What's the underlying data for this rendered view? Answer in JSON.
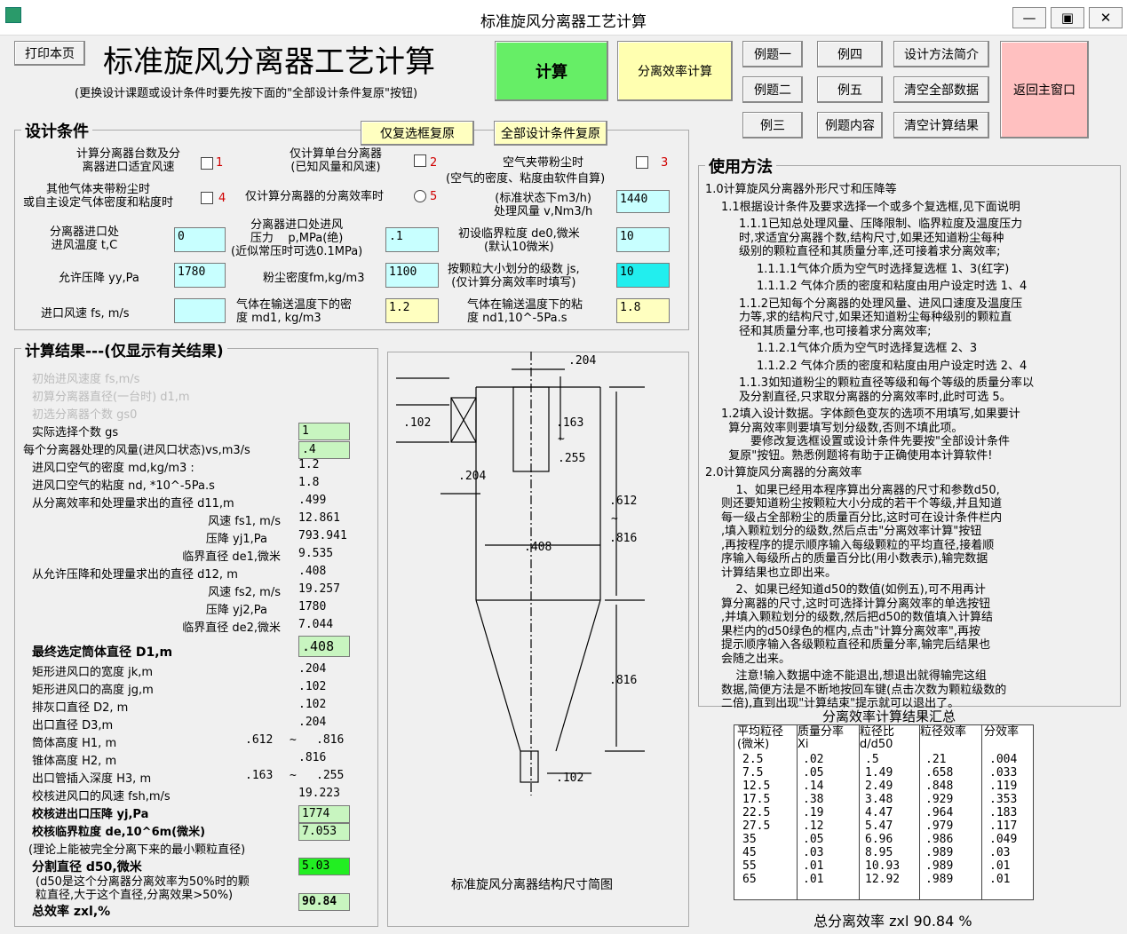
{
  "window": {
    "title": "标准旋风分离器工艺计算"
  },
  "header": {
    "print_button": "打印本页",
    "big_title": "标准旋风分离器工艺计算",
    "hint": "(更换设计课题或设计条件时要先按下面的\"全部设计条件复原\"按钮)",
    "calc_button": "计算",
    "eff_button": "分离效率计算",
    "examples": [
      "例题一",
      "例四",
      "例题二",
      "例五",
      "例三",
      "例题内容"
    ],
    "design_intro": "设计方法简介",
    "clear_all": "清空全部数据",
    "clear_results": "清空计算结果",
    "return_main": "返回主窗口",
    "reset_checked": "仅复选框复原",
    "reset_all": "全部设计条件复原"
  },
  "conditions": {
    "title": "设计条件",
    "opt1": {
      "text": "计算分离器台数及分\n离器进口适宜风速",
      "num": "1"
    },
    "opt2": {
      "text": "仅计算单台分离器\n(已知风量和风速)",
      "num": "2"
    },
    "opt3": {
      "text": "空气夹带粉尘时",
      "num": "3"
    },
    "opt3b": "(空气的密度、粘度由软件自算)",
    "opt4": {
      "text": "其他气体夹带粉尘时\n或自主设定气体密度和粘度时",
      "num": "4"
    },
    "opt5": {
      "text": "仅计算分离器的分离效率时",
      "num": "5"
    },
    "flow_label": "(标准状态下m3/h)\n处理风量 v,Nm3/h",
    "flow_value": "1440",
    "temp_label": "分离器进口处\n进风温度 t,C",
    "temp_value": "0",
    "pressure_label": "分离器进口处进风\n压力    p,MPa(绝)\n(近似常压时可选0.1MPa)",
    "pressure_value": ".1",
    "de0_label": "初设临界粒度 de0,微米\n(默认10微米)",
    "de0_value": "10",
    "allow_label": "允许压降 yy,Pa",
    "allow_value": "1780",
    "dust_label": "粉尘密度fm,kg/m3",
    "dust_value": "1100",
    "js_label": "按颗粒大小划分的级数 js,\n(仅计算分离效率时填写)",
    "js_value": "10",
    "fs_label": "进口风速 fs, m/s",
    "fs_value": "",
    "md1_label": "气体在输送温度下的密\n度 md1, kg/m3",
    "md1_value": "1.2",
    "nd1_label": "气体在输送温度下的粘\n度 nd1,10^-5Pa.s",
    "nd1_value": "1.8"
  },
  "results": {
    "title": "计算结果---(仅显示有关结果)",
    "gray_lines": [
      "初始进风速度 fs,m/s",
      "初算分离器直径(一台时) d1,m",
      "初选分离器个数 gs0"
    ],
    "gs_label": "实际选择个数 gs",
    "gs_value": "1",
    "vs_label": "每个分离器处理的风量(进风口状态)vs,m3/s",
    "vs_value": ".4",
    "rows_a": [
      {
        "label": "进风口空气的密度 md,kg/m3 :",
        "value": "1.2"
      },
      {
        "label": "进风口空气的粘度 nd, *10^-5Pa.s",
        "value": "1.8"
      },
      {
        "label": "从分离效率和处理量求出的直径 d11,m",
        "value": ".499"
      }
    ],
    "rows_a_right": [
      {
        "label": "风速 fs1, m/s",
        "value": "12.861"
      },
      {
        "label": "压降 yj1,Pa",
        "value": "793.941"
      },
      {
        "label": "临界直径 de1,微米",
        "value": "9.535"
      }
    ],
    "d12_label": "从允许压降和处理量求出的直径 d12, m",
    "d12_value": ".408",
    "rows_b_right": [
      {
        "label": "风速 fs2, m/s",
        "value": "19.257"
      },
      {
        "label": "压降 yj2,Pa",
        "value": "1780"
      },
      {
        "label": "临界直径 de2,微米",
        "value": "7.044"
      }
    ],
    "d1_label": "最终选定筒体直径 D1,m",
    "d1_value": ".408",
    "rows_c": [
      {
        "label": "矩形进风口的宽度 jk,m",
        "value": ".204"
      },
      {
        "label": "矩形进风口的高度 jg,m",
        "value": ".102"
      },
      {
        "label": "排灰口直径 D2, m",
        "value": ".102"
      },
      {
        "label": "出口直径 D3,m",
        "value": ".204"
      }
    ],
    "h1_label": "筒体高度 H1, m",
    "h1_from": ".612",
    "h1_tilde": "~",
    "h1_to": ".816",
    "h2_label": "锥体高度 H2, m",
    "h2_value": ".816",
    "h3_label": "出口管插入深度 H3, m",
    "h3_from": ".163",
    "h3_tilde": "~",
    "h3_to": ".255",
    "fsh_label": "校核进风口的风速 fsh,m/s",
    "fsh_value": "19.223",
    "yj_label": "校核进出口压降 yj,Pa",
    "yj_value": "1774",
    "de_label": "校核临界粒度 de,10^6m(微米)",
    "de_value": "7.053",
    "de_note": "(理论上能被完全分离下来的最小颗粒直径)",
    "d50_label": "分割直径 d50,微米",
    "d50_value": "5.03",
    "d50_note": "(d50是这个分离器分离效率为50%时的颗\n粒直径,大于这个直径,分离效果>50%)",
    "zxl_label": "总效率 zxl,%",
    "zxl_value": "90.84"
  },
  "diagram": {
    "caption": "标准旋风分离器结构尺寸简图",
    "dims": {
      "top": ".204",
      "inlet_h": ".102",
      "insert1": ".163",
      "tilde1": "~",
      "insert2": ".255",
      "inlet_w": ".204",
      "body1": ".612",
      "tilde2": "~",
      "body2": ".816",
      "dia": ".408",
      "cone": ".816",
      "bottom": ".102"
    }
  },
  "usage": {
    "title": "使用方法",
    "lines": [
      {
        "text": "1.0计算旋风分离器外形尺寸和压降等",
        "indent": 0
      },
      {
        "text": "1.1根据设计条件及要求选择一个或多个复选框,见下面说明",
        "indent": 1
      },
      {
        "text": "1.1.1已知总处理风量、压降限制、临界粒度及温度压力\n时,求适宜分离器个数,结构尺寸,如果还知道粉尘每种\n级别的颗粒直径和其质量分率,还可接着求分离效率;",
        "indent": 2
      },
      {
        "text": "1.1.1.1气体介质为空气时选择复选框 1、3(红字)",
        "indent": 3
      },
      {
        "text": "1.1.1.2 气体介质的密度和粘度由用户设定时选 1、4",
        "indent": 3
      },
      {
        "text": "1.1.2已知每个分离器的处理风量、进风口速度及温度压\n力等,求的结构尺寸,如果还知道粉尘每种级别的颗粒直\n径和其质量分率,也可接着求分离效率;",
        "indent": 2
      },
      {
        "text": "1.1.2.1气体介质为空气时选择复选框 2、3",
        "indent": 3
      },
      {
        "text": "1.1.2.2 气体介质的密度和粘度由用户设定时选 2、4",
        "indent": 3
      },
      {
        "text": "1.1.3如知道粉尘的颗粒直径等级和每个等级的质量分率以\n及分割直径,只求取分离器的分离效率时,此时可选 5。",
        "indent": 2
      },
      {
        "text": "1.2填入设计数据。字体颜色变灰的选项不用填写,如果要计\n  算分离效率则要填写划分级数,否则不填此项。\n        要修改复选框设置或设计条件先要按\"全部设计条件\n  复原\"按钮。熟悉例题将有助于正确使用本计算软件!",
        "indent": 1
      },
      {
        "text": "2.0计算旋风分离器的分离效率",
        "indent": 0
      },
      {
        "text": "    1、如果已经用本程序算出分离器的尺寸和参数d50,\n则还要知道粉尘按颗粒大小分成的若干个等级,并且知道\n每一级占全部粉尘的质量百分比,这时可在设计条件栏内\n,填入颗粒划分的级数,然后点击\"分离效率计算\"按钮\n,再按程序的提示顺序输入每级颗粒的平均直径,接着顺\n序输入每级所占的质量百分比(用小数表示),输完数据\n计算结果也立即出来。",
        "indent": 1
      },
      {
        "text": "    2、如果已经知道d50的数值(如例五),可不用再计\n算分离器的尺寸,这时可选择计算分离效率的单选按钮\n,并填入颗粒划分的级数,然后把d50的数值填入计算结\n果栏内的d50绿色的框内,点击\"计算分离效率\",再按\n提示顺序输入各级颗粒直径和质量分率,输完后结果也\n会随之出来。",
        "indent": 1
      },
      {
        "text": "    注意!输入数据中途不能退出,想退出就得输完这组\n数据,简便方法是不断地按回车键(点击次数为颗粒级数的\n二倍),直到出现\"计算结束\"提示就可以退出了。",
        "indent": 1
      }
    ]
  },
  "summary": {
    "title": "分离效率计算结果汇总",
    "headers": [
      "平均粒径\n(微米)",
      "质量分率\nXi",
      "粒径比\nd/d50",
      "粒径效率",
      "分效率"
    ],
    "rows": [
      [
        "2.5",
        ".02",
        ".5",
        ".21",
        ".004"
      ],
      [
        "7.5",
        ".05",
        "1.49",
        ".658",
        ".033"
      ],
      [
        "12.5",
        ".14",
        "2.49",
        ".848",
        ".119"
      ],
      [
        "17.5",
        ".38",
        "3.48",
        ".929",
        ".353"
      ],
      [
        "22.5",
        ".19",
        "4.47",
        ".964",
        ".183"
      ],
      [
        "27.5",
        ".12",
        "5.47",
        ".979",
        ".117"
      ],
      [
        "35",
        ".05",
        "6.96",
        ".986",
        ".049"
      ],
      [
        "45",
        ".03",
        "8.95",
        ".989",
        ".03"
      ],
      [
        "55",
        ".01",
        "10.93",
        ".989",
        ".01"
      ],
      [
        "65",
        ".01",
        "12.92",
        ".989",
        ".01"
      ]
    ],
    "total": "总分离效率 zxl 90.84 %"
  }
}
